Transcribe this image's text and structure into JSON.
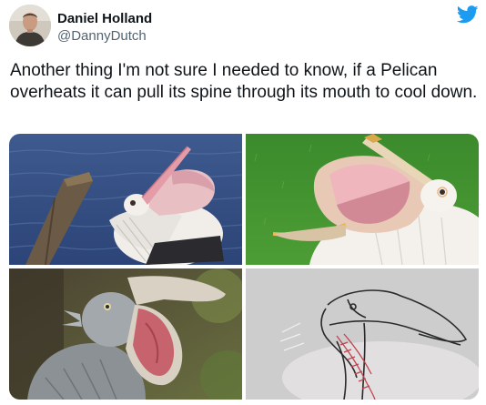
{
  "tweet": {
    "author_name": "Daniel Holland",
    "author_handle": "@DannyDutch",
    "text": "Another thing I'm not sure I needed to know, if a Pelican overheats it can pull its spine through its mouth to cool down.",
    "platform_icon": "twitter-bird-icon",
    "accent_color": "#1d9bf0"
  },
  "media": {
    "photos": [
      {
        "subject": "pelican-on-water"
      },
      {
        "subject": "pelican-on-grass"
      },
      {
        "subject": "shoebill-open-bill"
      },
      {
        "subject": "pelican-anatomy-drawing"
      }
    ]
  }
}
